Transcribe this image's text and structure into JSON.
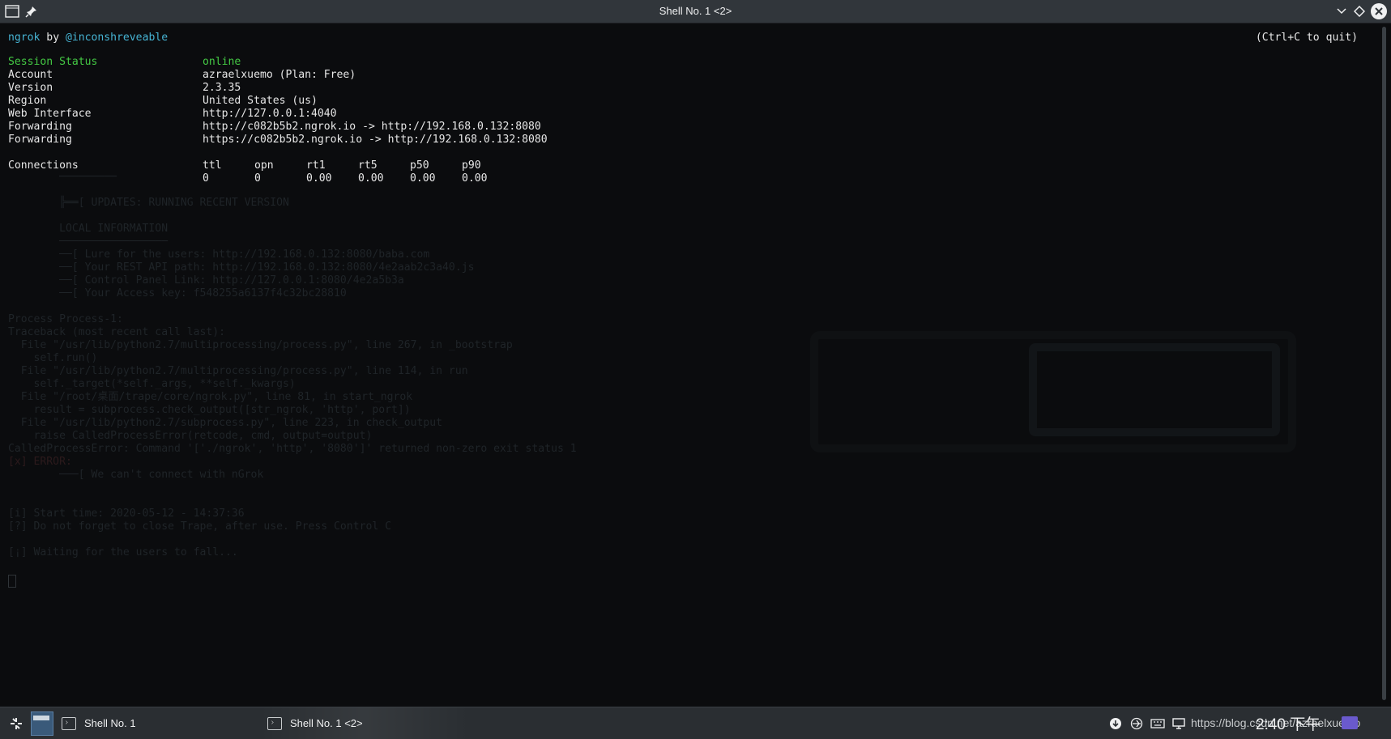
{
  "window": {
    "title": "Shell No. 1 <2>"
  },
  "terminal": {
    "banner_name": "ngrok",
    "banner_by": " by ",
    "banner_author": "@inconshreveable",
    "quit_hint": "(Ctrl+C to quit)",
    "session_status_label": "Session Status",
    "session_status_value": "online",
    "rows": [
      {
        "label": "Account",
        "value": "azraelxuemo (Plan: Free)"
      },
      {
        "label": "Version",
        "value": "2.3.35"
      },
      {
        "label": "Region",
        "value": "United States (us)"
      },
      {
        "label": "Web Interface",
        "value": "http://127.0.0.1:4040"
      },
      {
        "label": "Forwarding",
        "value": "http://c082b5b2.ngrok.io -> http://192.168.0.132:8080"
      },
      {
        "label": "Forwarding",
        "value": "https://c082b5b2.ngrok.io -> http://192.168.0.132:8080"
      }
    ],
    "connections_label": "Connections",
    "connections_headers": [
      "ttl",
      "opn",
      "rt1",
      "rt5",
      "p50",
      "p90"
    ],
    "connections_values": [
      "0",
      "0",
      "0.00",
      "0.00",
      "0.00",
      "0.00"
    ],
    "residue_lines": [
      "        ─────────",
      "",
      "        ╠══[ UPDATES: RUNNING RECENT VERSION",
      "",
      "        LOCAL INFORMATION",
      "        ─────────────────",
      "        ──[ Lure for the users: http://192.168.0.132:8080/baba.com",
      "        ──[ Your REST API path: http://192.168.0.132:8080/4e2aab2c3a40.js",
      "        ──[ Control Panel Link: http://127.0.0.1:8080/4e2a5b3a",
      "        ──[ Your Access key: f548255a6137f4c32bc28810",
      "",
      "Process Process-1:",
      "Traceback (most recent call last):",
      "  File \"/usr/lib/python2.7/multiprocessing/process.py\", line 267, in _bootstrap",
      "    self.run()",
      "  File \"/usr/lib/python2.7/multiprocessing/process.py\", line 114, in run",
      "    self._target(*self._args, **self._kwargs)",
      "  File \"/root/桌面/trape/core/ngrok.py\", line 81, in start_ngrok",
      "    result = subprocess.check_output([str_ngrok, 'http', port])",
      "  File \"/usr/lib/python2.7/subprocess.py\", line 223, in check_output",
      "    raise CalledProcessError(retcode, cmd, output=output)",
      "CalledProcessError: Command '['./ngrok', 'http', '8080']' returned non-zero exit status 1",
      "[x] ERROR:",
      "        ───[ We can't connect with nGrok",
      "",
      "",
      "[i] Start time: 2020-05-12 - 14:37:36",
      "[?] Do not forget to close Trape, after use. Press Control C",
      "",
      "[¡] Waiting for the users to fall..."
    ]
  },
  "taskbar": {
    "tasks": [
      "Shell No. 1",
      "Shell No. 1 <2>"
    ],
    "clock": "2:40 下午",
    "url": "https://blog.csdn.net/azraelxuemo"
  },
  "colors": {
    "accent_green": "#44c944",
    "accent_cyan": "#46b4d4",
    "titlebar_bg": "#31363b",
    "terminal_bg": "#0b0c0e"
  },
  "icons": [
    "terminal-icon",
    "pin-icon",
    "minimize-icon",
    "keep-above-icon",
    "close-icon",
    "app-launcher-icon",
    "pager-icon",
    "download-icon",
    "network-icon",
    "keyboard-icon",
    "display-icon",
    "input-method-icon"
  ]
}
